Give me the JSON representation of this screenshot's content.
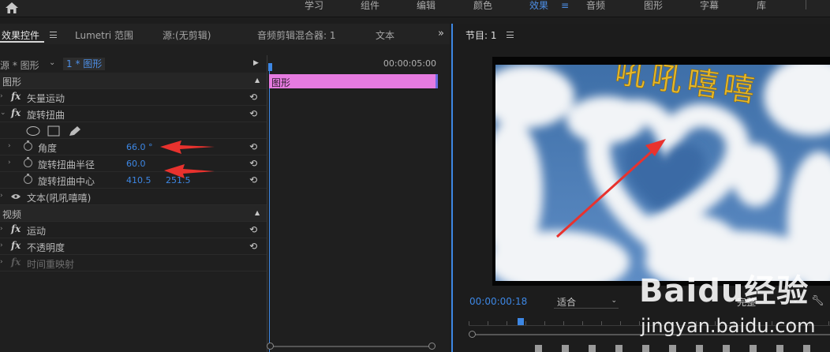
{
  "workspace_tabs": [
    {
      "label": "学习",
      "active": false
    },
    {
      "label": "组件",
      "active": false
    },
    {
      "label": "编辑",
      "active": false
    },
    {
      "label": "颜色",
      "active": false
    },
    {
      "label": "效果",
      "active": true
    },
    {
      "label": "音频",
      "active": false
    },
    {
      "label": "图形",
      "active": false
    },
    {
      "label": "字幕",
      "active": false
    },
    {
      "label": "库",
      "active": false
    }
  ],
  "left_panel": {
    "tabs": [
      "效果控件",
      "Lumetri 范围",
      "源:(无剪辑)",
      "音频剪辑混合器: 1",
      "文本"
    ],
    "source": "源 * 图形",
    "sequence": "1 * 图形",
    "timeline_timecode": "00:00:05:00",
    "clip_label": "图形",
    "sections": {
      "graphics": "图形",
      "video": "视频"
    },
    "effects": {
      "vector_motion": "矢量运动",
      "twirl": "旋转扭曲",
      "angle": {
        "label": "角度",
        "value": "66.0 °"
      },
      "twirl_radius": {
        "label": "旋转扭曲半径",
        "value": "60.0"
      },
      "twirl_center": {
        "label": "旋转扭曲中心",
        "x": "410.5",
        "y": "251.5"
      },
      "text_layer": "文本(吼吼嘻嘻)",
      "motion": "运动",
      "opacity": "不透明度",
      "time_remap": "时间重映射"
    },
    "fx_label": "fx"
  },
  "monitor": {
    "title": "节目: 1",
    "timecode": "00:00:00:18",
    "fit": "适合",
    "quality": "完整",
    "overlay_text": "吼吼嘻嘻"
  },
  "watermark": {
    "logo": "Baidu经验",
    "url": "jingyan.baidu.com"
  },
  "colors": {
    "accent": "#3d87e4",
    "clip": "#e67be0",
    "arrow": "#e8322e",
    "overlay_text": "#e6b82a"
  }
}
